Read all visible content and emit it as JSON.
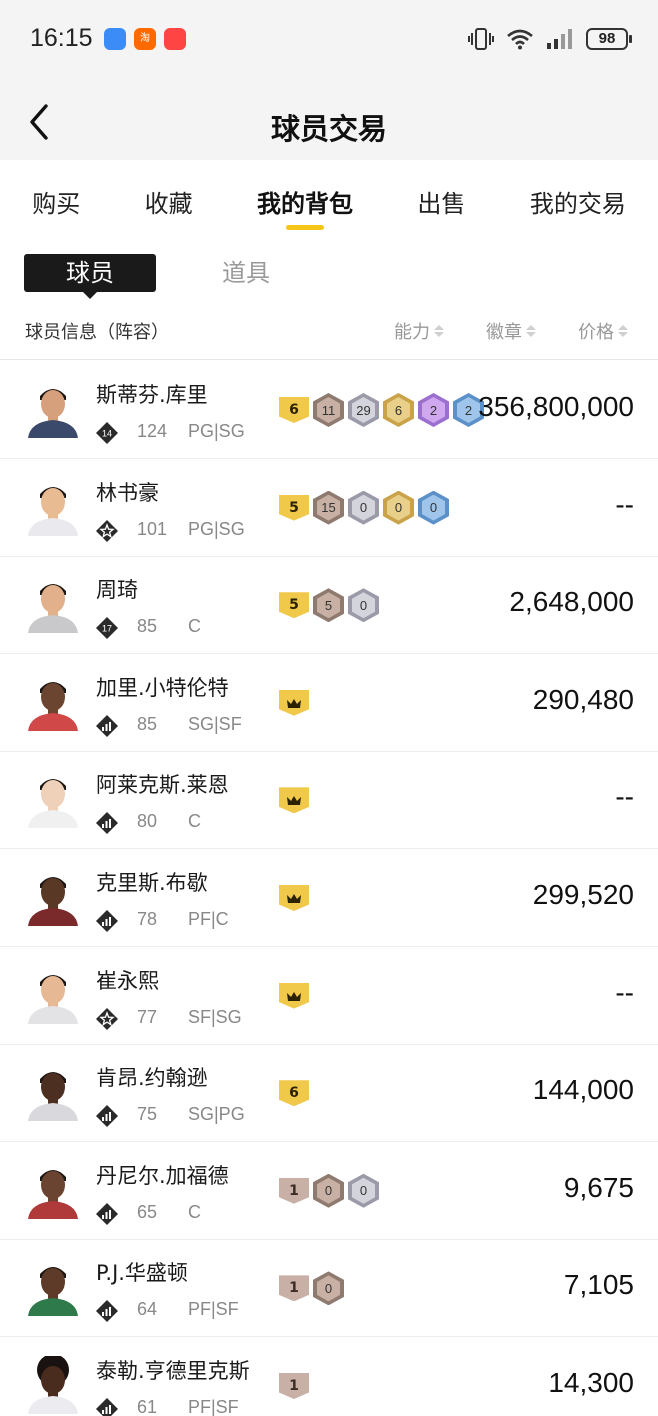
{
  "status_bar": {
    "time": "16:15",
    "notifications": [
      {
        "icon": "message-app-icon",
        "color": "#3b8cf6",
        "label": ""
      },
      {
        "icon": "taobao-app-icon",
        "color": "#ff6a00",
        "label": "淘"
      },
      {
        "icon": "shopping-app-icon",
        "color": "#ff4444",
        "label": ""
      }
    ],
    "battery": "98"
  },
  "header": {
    "title": "球员交易"
  },
  "tabs": [
    {
      "label": "购买",
      "active": false
    },
    {
      "label": "收藏",
      "active": false
    },
    {
      "label": "我的背包",
      "active": true
    },
    {
      "label": "出售",
      "active": false
    },
    {
      "label": "我的交易",
      "active": false
    }
  ],
  "subtabs": [
    {
      "label": "球员",
      "active": true
    },
    {
      "label": "道具",
      "active": false
    }
  ],
  "columns": {
    "info": "球员信息（阵容）",
    "ability": "能力",
    "badge": "徽章",
    "price": "价格"
  },
  "colors": {
    "accent": "#f5c518",
    "gold_badge": "#f0c84a",
    "bronze_badge": "#c9b0a6",
    "silver_badge": "#c9c9d3",
    "purple_badge": "#c9a6e8",
    "blue_badge": "#8db7e0"
  },
  "players": [
    {
      "name": "斯蒂芬.库里",
      "rank": "14",
      "rating": "124",
      "positions": "PG|SG",
      "price": "356,800,000",
      "level": {
        "type": "gold",
        "value": "6"
      },
      "badges": [
        {
          "tier": "bronze",
          "value": "11"
        },
        {
          "tier": "silver",
          "value": "29"
        },
        {
          "tier": "gold",
          "value": "6"
        },
        {
          "tier": "purple",
          "value": "2"
        },
        {
          "tier": "blue",
          "value": "2"
        }
      ]
    },
    {
      "name": "林书豪",
      "rank": "star",
      "rating": "101",
      "positions": "PG|SG",
      "price": "--",
      "level": {
        "type": "gold",
        "value": "5"
      },
      "badges": [
        {
          "tier": "bronze",
          "value": "15"
        },
        {
          "tier": "silver",
          "value": "0"
        },
        {
          "tier": "gold",
          "value": "0"
        },
        {
          "tier": "blue",
          "value": "0"
        }
      ]
    },
    {
      "name": "周琦",
      "rank": "17",
      "rating": "85",
      "positions": "C",
      "price": "2,648,000",
      "level": {
        "type": "gold",
        "value": "5"
      },
      "badges": [
        {
          "tier": "bronze",
          "value": "5"
        },
        {
          "tier": "silver",
          "value": "0"
        }
      ]
    },
    {
      "name": "加里.小特伦特",
      "rank": "bars",
      "rating": "85",
      "positions": "SG|SF",
      "price": "290,480",
      "level": {
        "type": "crown",
        "value": ""
      },
      "badges": []
    },
    {
      "name": "阿莱克斯.莱恩",
      "rank": "bars",
      "rating": "80",
      "positions": "C",
      "price": "--",
      "level": {
        "type": "crown",
        "value": ""
      },
      "badges": []
    },
    {
      "name": "克里斯.布歇",
      "rank": "bars",
      "rating": "78",
      "positions": "PF|C",
      "price": "299,520",
      "level": {
        "type": "crown",
        "value": ""
      },
      "badges": []
    },
    {
      "name": "崔永熙",
      "rank": "star",
      "rating": "77",
      "positions": "SF|SG",
      "price": "--",
      "level": {
        "type": "crown",
        "value": ""
      },
      "badges": []
    },
    {
      "name": "肯昂.约翰逊",
      "rank": "bars",
      "rating": "75",
      "positions": "SG|PG",
      "price": "144,000",
      "level": {
        "type": "gold",
        "value": "6"
      },
      "badges": []
    },
    {
      "name": "丹尼尔.加福德",
      "rank": "bars",
      "rating": "65",
      "positions": "C",
      "price": "9,675",
      "level": {
        "type": "bronze",
        "value": "1"
      },
      "badges": [
        {
          "tier": "bronze",
          "value": "0"
        },
        {
          "tier": "silver",
          "value": "0"
        }
      ]
    },
    {
      "name": "P.J.华盛顿",
      "rank": "bars",
      "rating": "64",
      "positions": "PF|SF",
      "price": "7,105",
      "level": {
        "type": "bronze",
        "value": "1"
      },
      "badges": [
        {
          "tier": "bronze",
          "value": "0"
        }
      ]
    },
    {
      "name": "泰勒.亨德里克斯",
      "rank": "bars",
      "rating": "61",
      "positions": "PF|SF",
      "price": "14,300",
      "level": {
        "type": "bronze",
        "value": "1"
      },
      "badges": []
    }
  ]
}
